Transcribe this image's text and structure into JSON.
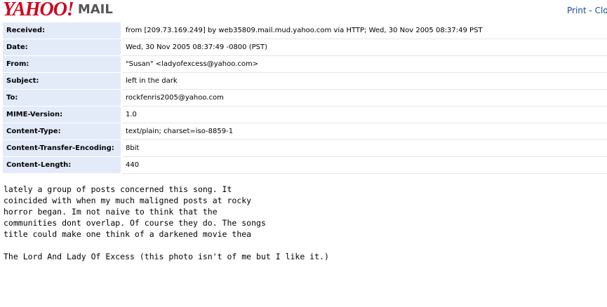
{
  "brand": {
    "logo_text": "YAHOO!",
    "product": "MAIL",
    "logo_color": "#d0021b"
  },
  "top_links": {
    "print": "Print",
    "separator": " - ",
    "close": "Clo",
    "link_color": "#1a4a94"
  },
  "headers": [
    {
      "name": "Received:",
      "value": "from [209.73.169.249] by web35809.mail.mud.yahoo.com via HTTP; Wed, 30 Nov 2005 08:37:49 PST"
    },
    {
      "name": "Date:",
      "value": "Wed, 30 Nov 2005 08:37:49 -0800 (PST)"
    },
    {
      "name": "From:",
      "value": "\"Susan\" <ladyofexcess@yahoo.com>"
    },
    {
      "name": "Subject:",
      "value": "left in the dark"
    },
    {
      "name": "To:",
      "value": "rockfenris2005@yahoo.com"
    },
    {
      "name": "MIME-Version:",
      "value": "1.0"
    },
    {
      "name": "Content-Type:",
      "value": "text/plain; charset=iso-8859-1"
    },
    {
      "name": "Content-Transfer-Encoding:",
      "value": "8bit"
    },
    {
      "name": "Content-Length:",
      "value": "440"
    }
  ],
  "header_label_bg": "#e3ebf9",
  "message_lines": [
    "lately a group of posts concerned this song. It",
    "coincided with when my much maligned posts at rocky",
    "horror began. Im not naive to think that the",
    "communities dont overlap. Of course they do. The songs",
    "title could make one think of a darkened movie thea",
    "",
    "The Lord And Lady Of Excess (this photo isn't of me but I like it.)"
  ]
}
